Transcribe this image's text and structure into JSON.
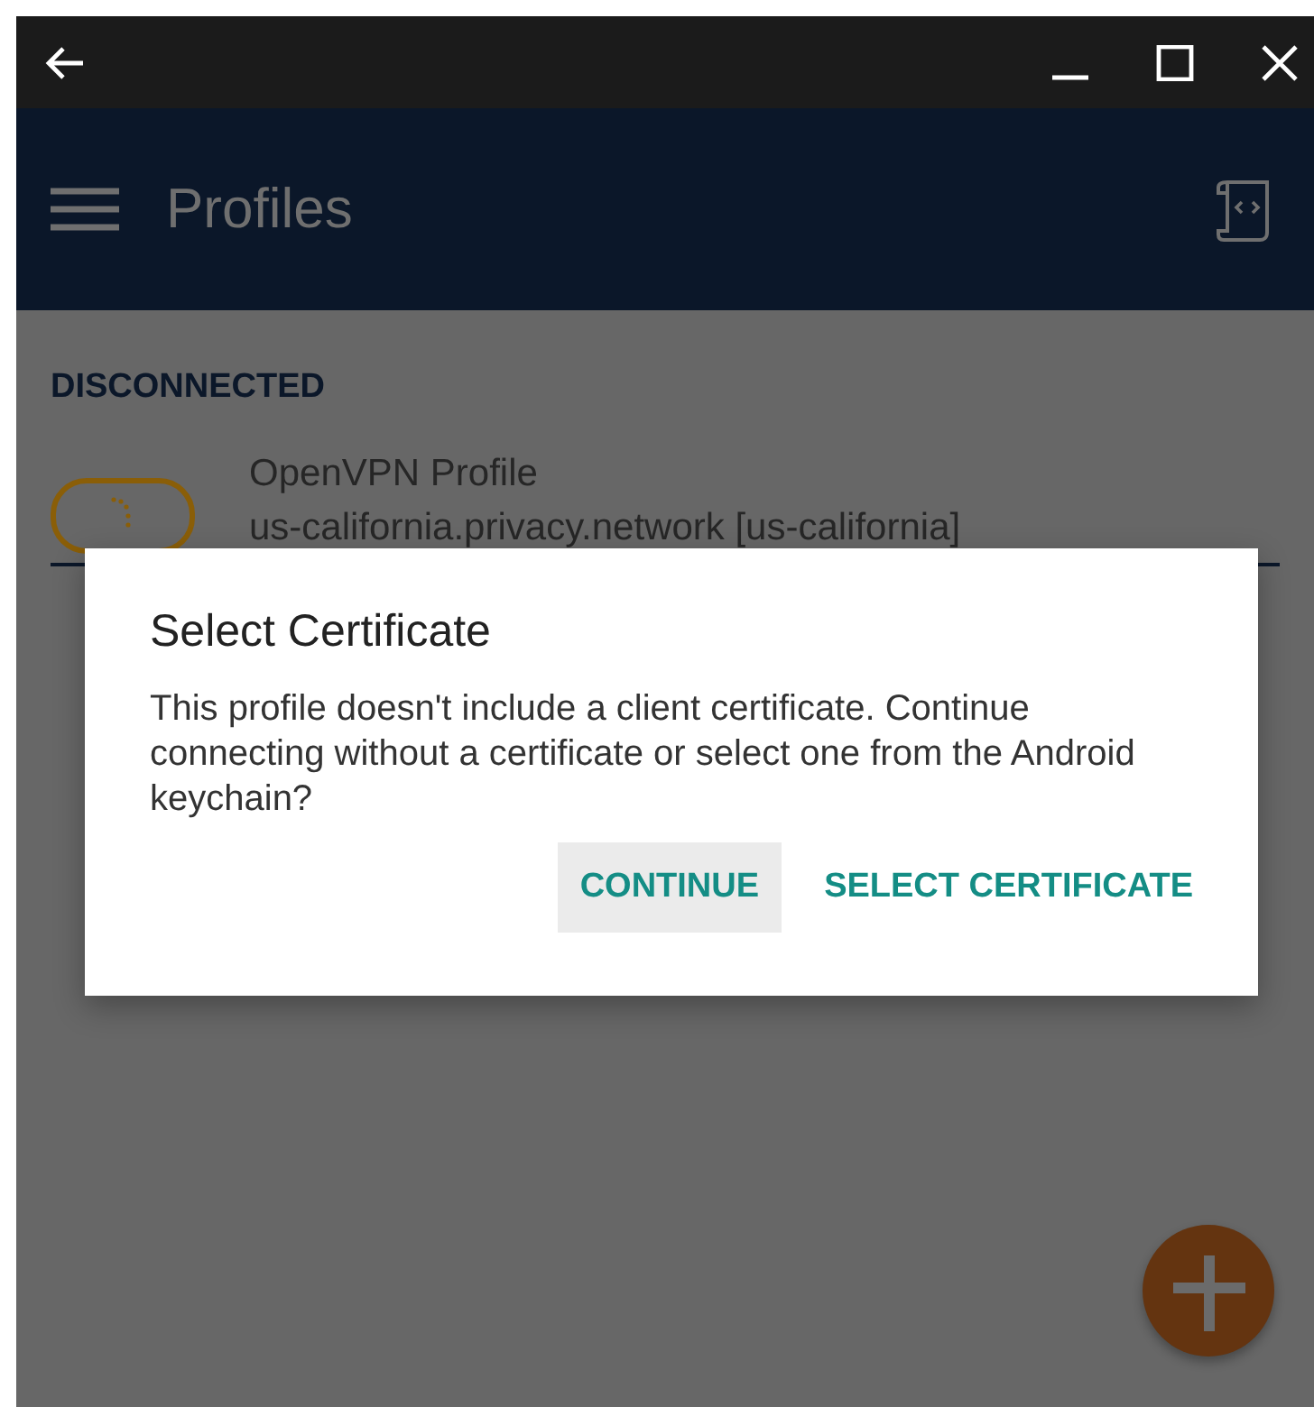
{
  "app_bar": {
    "title": "Profiles"
  },
  "section": {
    "heading": "DISCONNECTED"
  },
  "profiles": [
    {
      "name": "OpenVPN Profile",
      "server": "us-california.privacy.network [us-california]",
      "on": false
    }
  ],
  "dialog": {
    "title": "Select Certificate",
    "message": "This profile doesn't include a client certificate. Continue connecting without a certificate or select one from the Android keychain?",
    "buttons": [
      {
        "label": "CONTINUE",
        "selected": true
      },
      {
        "label": "SELECT CERTIFICATE",
        "selected": false
      }
    ]
  }
}
